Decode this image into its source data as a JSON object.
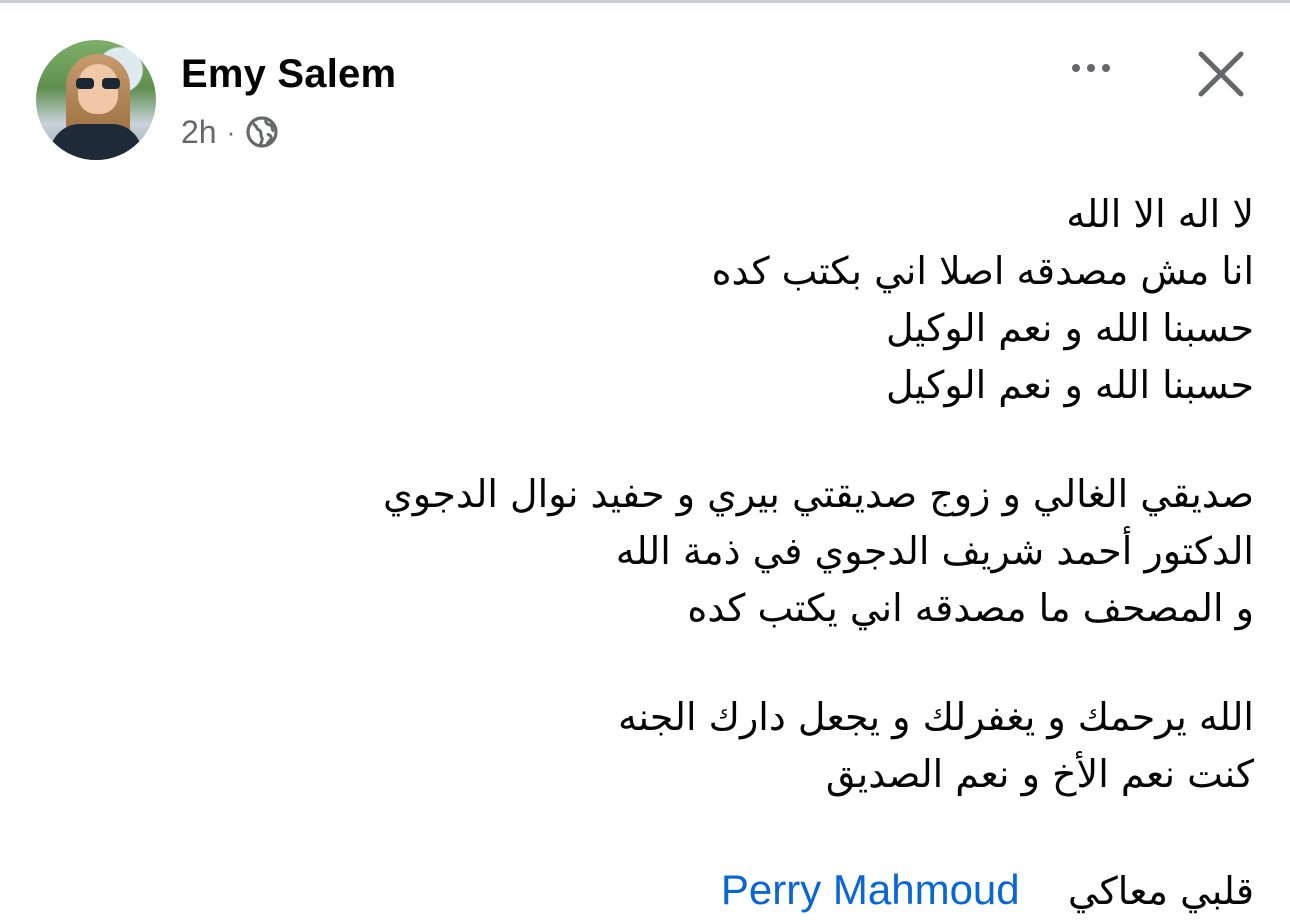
{
  "post": {
    "author": "Emy Salem",
    "time": "2h",
    "separator": "·",
    "audience_icon": "globe-icon",
    "menu_icon": "more-horizontal-icon",
    "close_icon": "close-icon",
    "lines": [
      "لا اله الا الله",
      "انا مش مصدقه اصلا اني بكتب كده",
      "حسبنا الله و نعم الوكيل",
      "حسبنا الله و نعم الوكيل",
      "",
      "صديقي الغالي و زوج صديقتي بيري و حفيد نوال الدجوي",
      "الدكتور أحمد شريف الدجوي في ذمة الله",
      "و المصحف ما مصدقه اني يكتب كده",
      "",
      "الله  يرحمك و يغفرلك و يجعل دارك الجنه",
      "كنت نعم الأخ و نعم الصديق"
    ],
    "closing_text": "قلبي معاكي",
    "mention": "Perry Mahmoud"
  },
  "colors": {
    "text": "#050505",
    "secondary": "#65676b",
    "link": "#0866d6",
    "background": "#ffffff"
  }
}
